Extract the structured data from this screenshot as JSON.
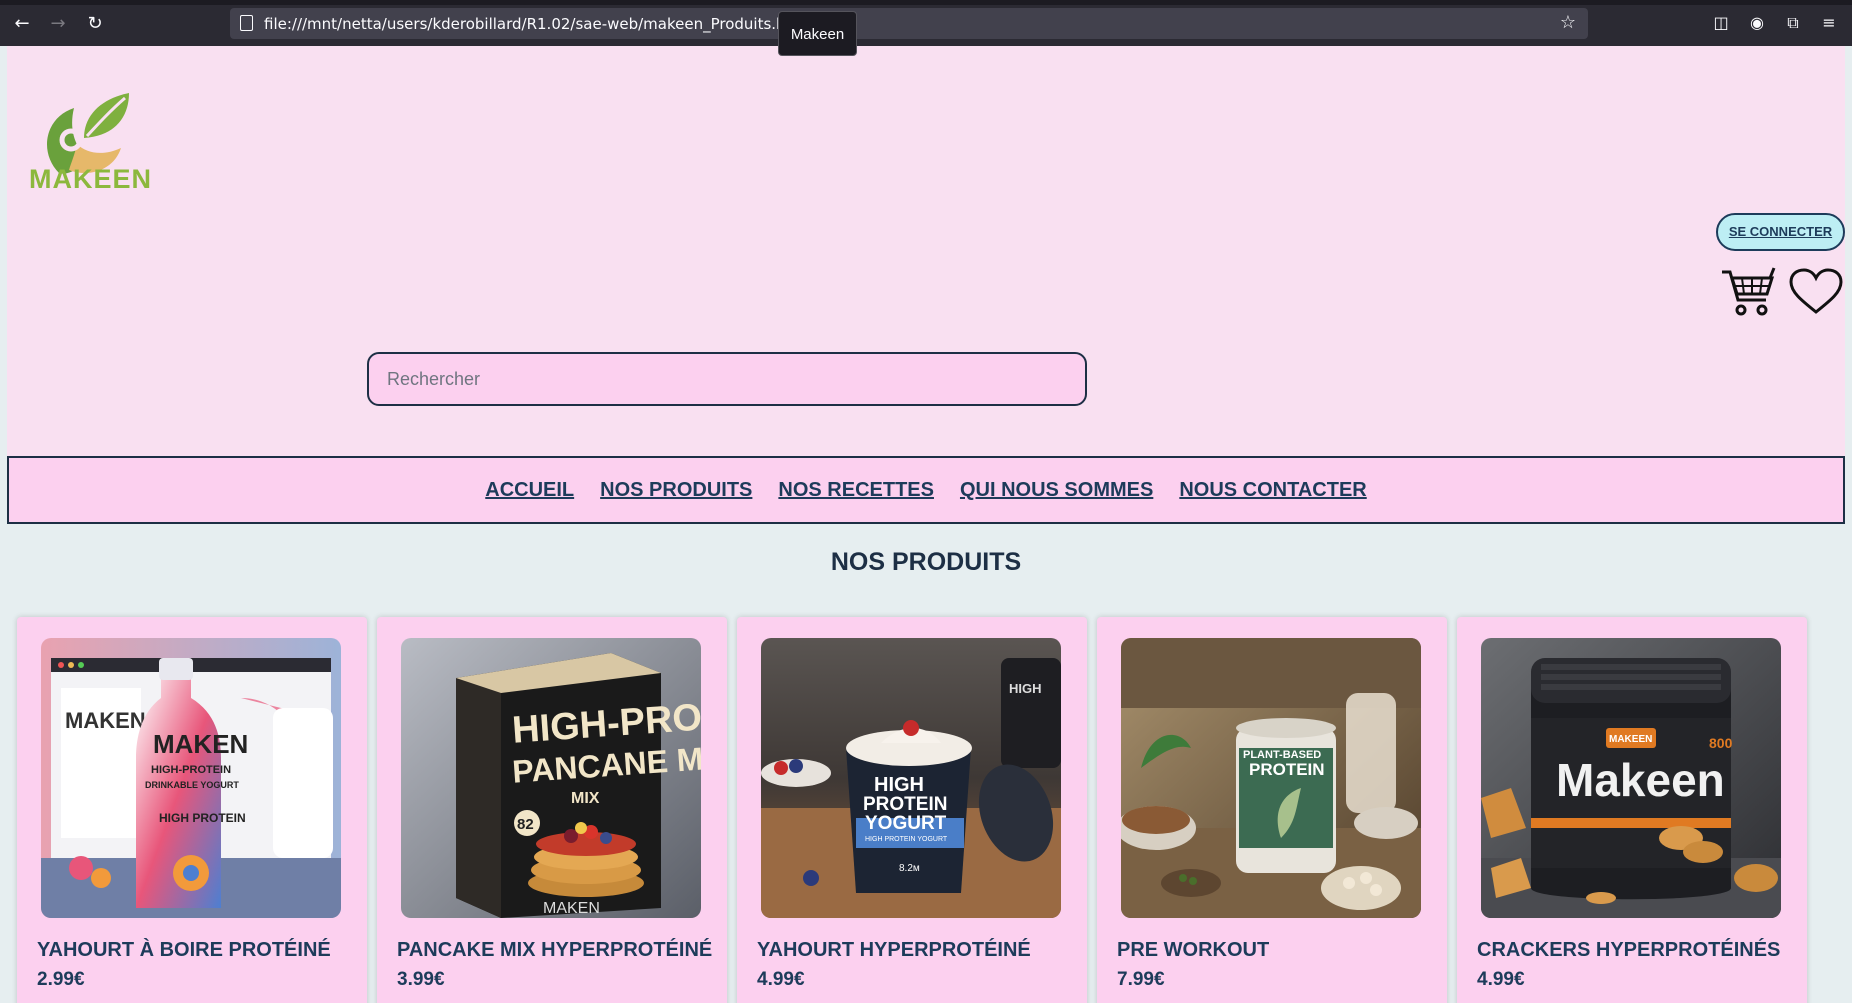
{
  "browser": {
    "url": "file:///mnt/netta/users/kderobillard/R1.02/sae-web/makeen_Produits.html",
    "tooltip": "Makeen"
  },
  "header": {
    "logo_text": "MAKEEN",
    "login_label": "SE CONNECTER",
    "search_placeholder": "Rechercher"
  },
  "nav": {
    "items": [
      "ACCUEIL",
      "NOS PRODUITS",
      "NOS RECETTES",
      "QUI NOUS SOMMES",
      "NOUS CONTACTER"
    ]
  },
  "section_title": "NOS PRODUITS",
  "products": [
    {
      "name": "YAHOURT À BOIRE PROTÉINÉ",
      "price": "2.99€",
      "image_text": [
        "MAKEN",
        "HIGH-PROTEIN",
        "DRINKABLE YOGURT",
        "HIGH PROTEIN"
      ]
    },
    {
      "name": "PANCAKE MIX HYPERPROTÉINÉ",
      "price": "3.99€",
      "image_text": [
        "HIGH-PROTEIN",
        "PANCANE MIX",
        "MIX",
        "82",
        "MAKEN"
      ]
    },
    {
      "name": "YAHOURT HYPERPROTÉINÉ",
      "price": "4.99€",
      "image_text": [
        "HIGH",
        "PROTEIN",
        "YOGURT",
        "HIGH PROTEIN YOGURT",
        "8.2м"
      ]
    },
    {
      "name": "PRE WORKOUT",
      "price": "7.99€",
      "image_text": [
        "PLANT-BASED",
        "PROTEIN"
      ]
    },
    {
      "name": "CRACKERS HYPERPROTÉINÉS",
      "price": "4.99€",
      "image_text": [
        "MAKEEN",
        "Makeen",
        "800"
      ]
    }
  ],
  "colors": {
    "header_bg": "#f9e0f1",
    "nav_bg": "#fcd0ef",
    "card_bg": "#fcd0ef",
    "text_dark": "#1d3b5a",
    "login_bg": "#bdeef4",
    "logo_green": "#8cb83d"
  }
}
